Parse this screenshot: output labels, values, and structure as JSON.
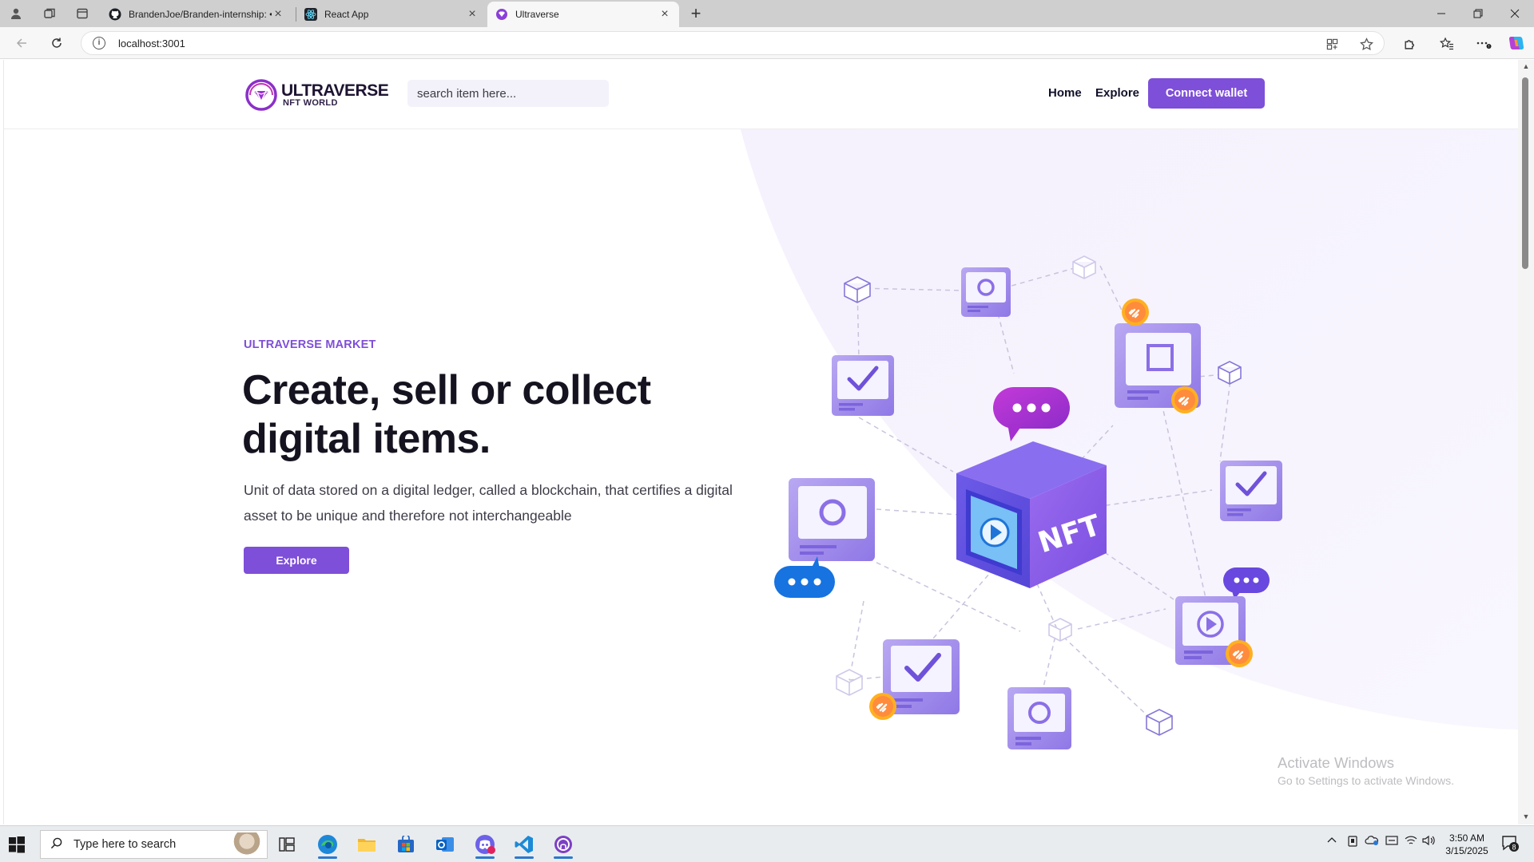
{
  "browser": {
    "tabs": [
      {
        "title": "BrandenJoe/Branden-internship: •",
        "favicon": "github-icon",
        "active": false
      },
      {
        "title": "React App",
        "favicon": "react-icon",
        "active": false
      },
      {
        "title": "Ultraverse",
        "favicon": "ultraverse-icon",
        "active": true
      }
    ],
    "url": "localhost:3001"
  },
  "site": {
    "logo_line1": "ULTRAVERSE",
    "logo_line2": "NFT WORLD",
    "search_placeholder": "search item here...",
    "nav": {
      "home": "Home",
      "explore": "Explore",
      "connect": "Connect wallet"
    },
    "hero": {
      "kicker": "ULTRAVERSE MARKET",
      "headline": "Create, sell or collect digital items.",
      "paragraph": "Unit of data stored on a digital ledger, called a blockchain, that certifies a digital asset to be unique and therefore not interchangeable",
      "button": "Explore"
    },
    "illustration_label": "NFT"
  },
  "watermark": {
    "line1": "Activate Windows",
    "line2": "Go to Settings to activate Windows."
  },
  "taskbar": {
    "search_placeholder": "Type here to search",
    "time": "3:50 AM",
    "date": "3/15/2025",
    "notification_count": "8",
    "apps": [
      "task-view-icon",
      "edge-icon",
      "file-explorer-icon",
      "store-icon",
      "outlook-icon",
      "discord-icon",
      "vscode-icon",
      "github-desktop-icon"
    ]
  },
  "colors": {
    "accent": "#7e4fd8",
    "hero_bg": "#f6f3fd",
    "headline": "#15131f"
  }
}
